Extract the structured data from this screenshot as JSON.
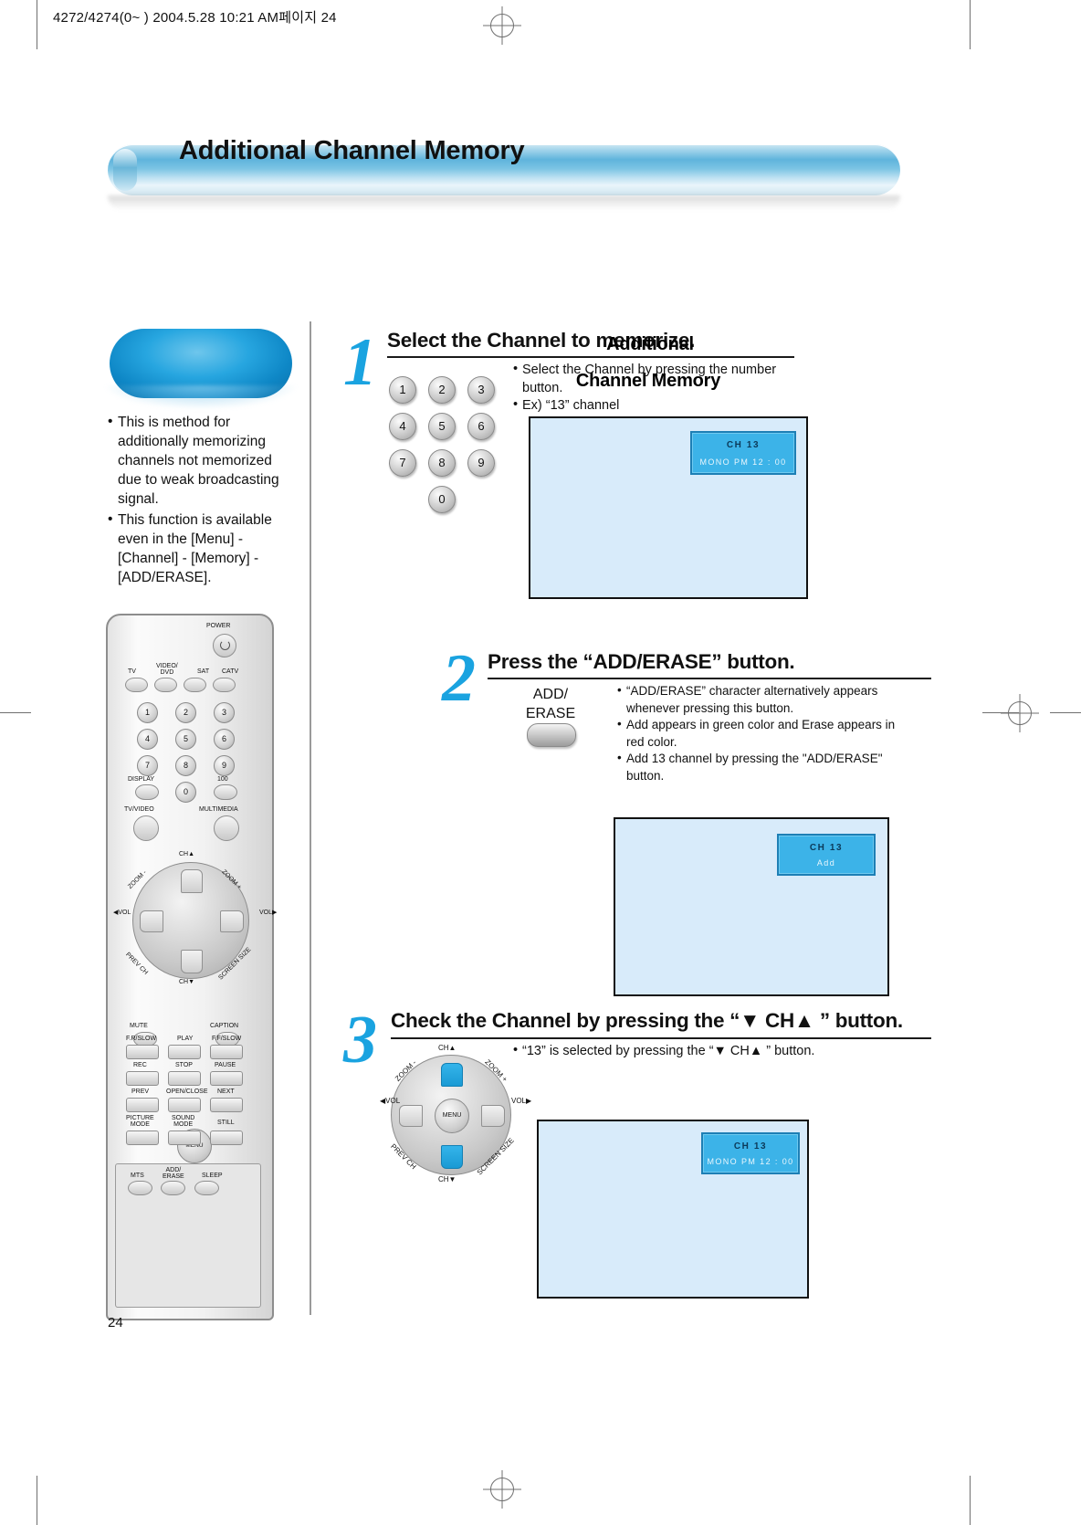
{
  "slug": "4272/4274(0~ )  2004.5.28 10:21 AM페이지 24",
  "banner": {
    "title": "Additional Channel Memory"
  },
  "sidebar": {
    "pill_line1": "Additional",
    "pill_line2": "Channel Memory",
    "bullets": [
      "This is method for additionally memorizing channels not memorized due to weak broadcasting signal.",
      "This function is available even in the [Menu] - [Channel] - [Memory] - [ADD/ERASE]."
    ]
  },
  "remote": {
    "power": "POWER",
    "sources": [
      "TV",
      "VIDEO/\nDVD",
      "SAT",
      "CATV"
    ],
    "keys": [
      "1",
      "2",
      "3",
      "4",
      "5",
      "6",
      "7",
      "8",
      "9",
      "0"
    ],
    "display": "DISPLAY",
    "hundred": "100",
    "tv_video": "TV/VIDEO",
    "multimedia": "MULTIMEDIA",
    "ch_up": "CH▲",
    "ch_down": "CH▼",
    "zoom_minus": "ZOOM -",
    "zoom_plus": "ZOOM +",
    "vol_left": "◀ V O L",
    "vol_right": "V O L ▶",
    "prev_ch": "PREV CH",
    "screen_size": "SCREEN SIZE",
    "menu": "MENU",
    "mute": "MUTE",
    "caption": "CAPTION",
    "fr_slow": "F.R/SLOW",
    "play": "PLAY",
    "ff_slow": "F.F/SLOW",
    "rec": "REC",
    "stop": "STOP",
    "pause": "PAUSE",
    "prev": "PREV",
    "open_close": "OPEN/CLOSE",
    "next": "NEXT",
    "picture_mode": "PICTURE\nMODE",
    "sound_mode": "SOUND\nMODE",
    "still": "STILL",
    "mts": "MTS",
    "add_erase": "ADD/\nERASE",
    "sleep": "SLEEP"
  },
  "steps": [
    {
      "number": "1",
      "heading": "Select the Channel to memorize.",
      "notes": [
        "Select the Channel by pressing the number button.",
        "Ex) “13” channel"
      ],
      "keypad": [
        "1",
        "2",
        "3",
        "4",
        "5",
        "6",
        "7",
        "8",
        "9",
        "0"
      ],
      "osd": {
        "line1": "CH 13",
        "line2": "MONO PM  12 : 00"
      }
    },
    {
      "number": "2",
      "heading": "Press the “ADD/ERASE” button.",
      "button_label_line1": "ADD/",
      "button_label_line2": "ERASE",
      "notes": [
        "“ADD/ERASE” character alternatively appears whenever pressing this button.",
        "Add appears in green color and Erase appears in red color.",
        "Add 13 channel by pressing the \"ADD/ERASE\" button."
      ],
      "osd": {
        "line1": "CH 13",
        "line2": "Add"
      }
    },
    {
      "number": "3",
      "heading": "Check the Channel by pressing the “▼ CH▲ ” button.",
      "notes": [
        "“13” is selected by pressing the “▼ CH▲ ” button."
      ],
      "dpad": {
        "ch_up": "CH▲",
        "ch_down": "CH▼",
        "zoom_minus": "ZOOM -",
        "zoom_plus": "ZOOM +",
        "vol_left": "◀ V O L",
        "vol_right": "V O L ▶",
        "prev_ch": "PREV CH",
        "screen_size": "SCREEN SIZE",
        "menu": "MENU"
      },
      "osd": {
        "line1": "CH 13",
        "line2": "MONO PM  12 : 00"
      }
    }
  ],
  "page_number": "24",
  "colors": {
    "accent_blue": "#1aa3e0",
    "osd_blue": "#3cb3e8",
    "screen_blue": "#d8ebfa"
  }
}
